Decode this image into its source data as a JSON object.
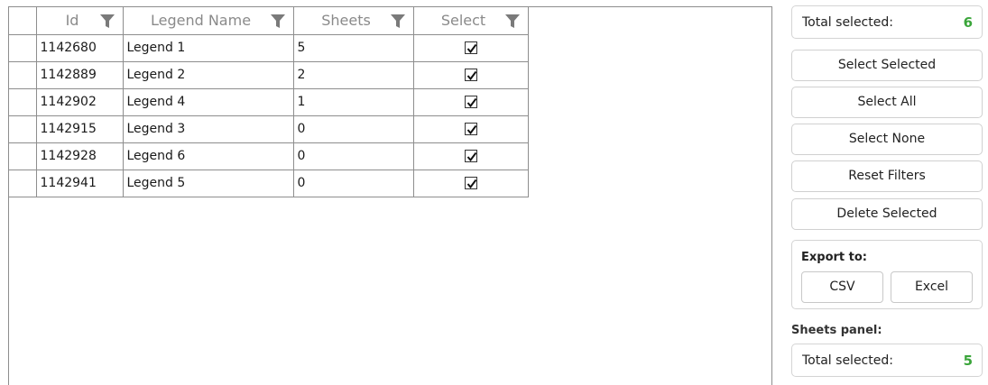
{
  "grid": {
    "columns": [
      {
        "label": "Id",
        "filter_icon": "filter-icon"
      },
      {
        "label": "Legend Name",
        "filter_icon": "filter-icon"
      },
      {
        "label": "Sheets",
        "filter_icon": "filter-icon"
      },
      {
        "label": "Select",
        "filter_icon": "filter-icon"
      }
    ],
    "rows": [
      {
        "id": "1142680",
        "name": "Legend 1",
        "sheets": "5",
        "selected": true
      },
      {
        "id": "1142889",
        "name": "Legend 2",
        "sheets": "2",
        "selected": true
      },
      {
        "id": "1142902",
        "name": "Legend 4",
        "sheets": "1",
        "selected": true
      },
      {
        "id": "1142915",
        "name": "Legend 3",
        "sheets": "0",
        "selected": true
      },
      {
        "id": "1142928",
        "name": "Legend 6",
        "sheets": "0",
        "selected": true
      },
      {
        "id": "1142941",
        "name": "Legend 5",
        "sheets": "0",
        "selected": true
      }
    ]
  },
  "side": {
    "total": {
      "label": "Total selected:",
      "value": "6"
    },
    "buttons": {
      "select_selected": "Select Selected",
      "select_all": "Select All",
      "select_none": "Select None",
      "reset_filters": "Reset Filters",
      "delete_selected": "Delete Selected"
    },
    "export": {
      "label": "Export to:",
      "csv": "CSV",
      "excel": "Excel"
    },
    "sheets_panel": {
      "label": "Sheets panel:",
      "total_label": "Total selected:",
      "total_value": "5"
    }
  },
  "colors": {
    "accent_green": "#3aa53a",
    "grid_border": "#8e8e8e",
    "header_text": "#8a8a8a"
  }
}
